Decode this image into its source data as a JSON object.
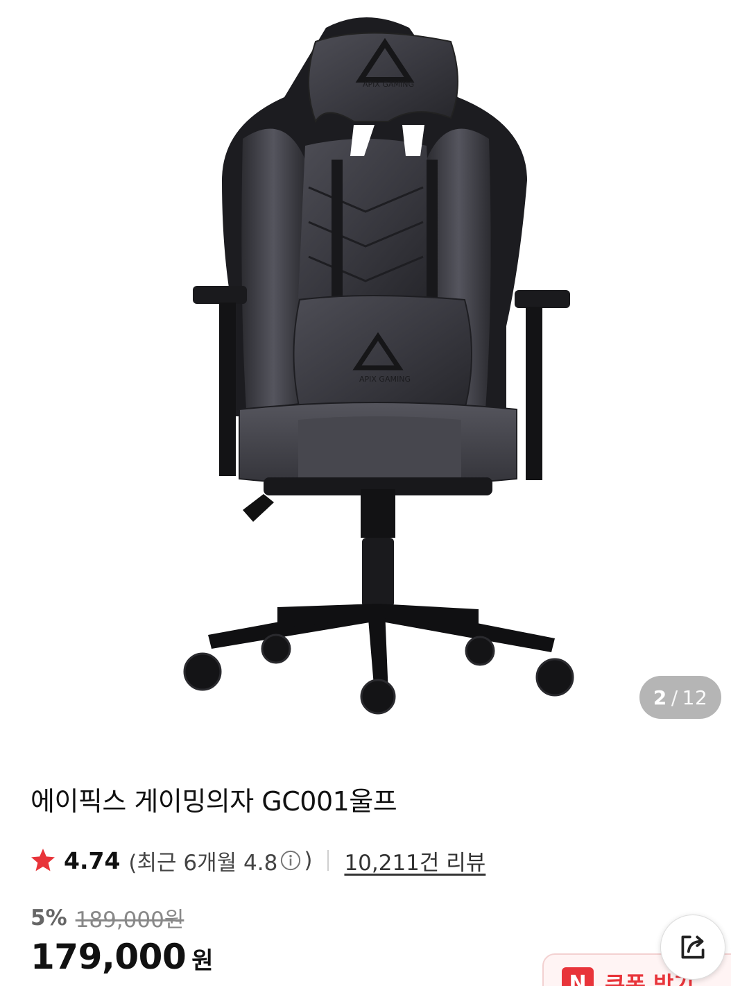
{
  "gallery": {
    "current": "2",
    "separator": "/",
    "total": "12",
    "image": {
      "headrest_logo": "APIX GAMING",
      "lumbar_logo": "APIX GAMING"
    }
  },
  "product": {
    "title": "에이픽스 게이밍의자 GC001울프",
    "rating": {
      "score": "4.74",
      "recent_prefix": "(최근 6개월 4.8",
      "recent_suffix": ")",
      "reviews": "10,211건 리뷰"
    },
    "discount_rate": "5%",
    "original_price": "189,000원",
    "sale_price": "179,000",
    "price_unit": "원"
  },
  "coupon": {
    "badge": "N",
    "label": "쿠폰 받기"
  },
  "colors": {
    "star": "#e8343a",
    "accent": "#e8343a",
    "chair": "#3a3a40"
  },
  "icons": {
    "star": "star-icon",
    "info": "info-icon",
    "share": "share-icon"
  }
}
